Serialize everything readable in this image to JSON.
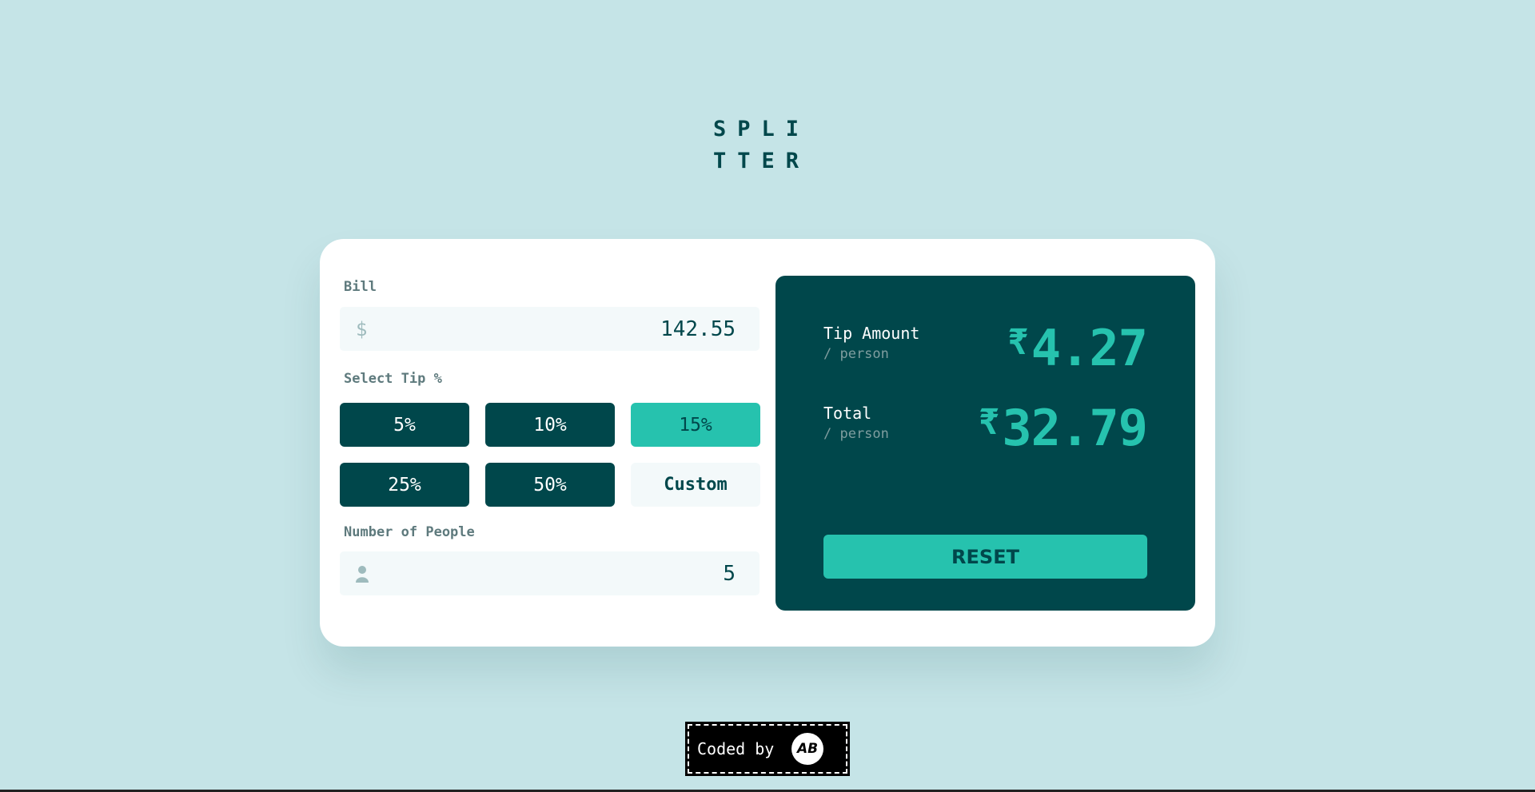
{
  "logo": {
    "line1": "SPLI",
    "line2": "TTER"
  },
  "bill": {
    "label": "Bill",
    "currency_symbol": "$",
    "value": "142.55"
  },
  "tip": {
    "label": "Select Tip %",
    "options": [
      {
        "label": "5%",
        "selected": false
      },
      {
        "label": "10%",
        "selected": false
      },
      {
        "label": "15%",
        "selected": true
      },
      {
        "label": "25%",
        "selected": false
      },
      {
        "label": "50%",
        "selected": false
      }
    ],
    "custom_label": "Custom"
  },
  "people": {
    "label": "Number of People",
    "value": "5"
  },
  "results": {
    "tip_amount": {
      "label": "Tip Amount",
      "per_label": "/ person",
      "currency": "₹",
      "value": "4.27"
    },
    "total": {
      "label": "Total",
      "per_label": "/ person",
      "currency": "₹",
      "value": "32.79"
    },
    "reset_label": "RESET"
  },
  "footer": {
    "coded_by": "Coded by",
    "logo_text": "AB"
  },
  "colors": {
    "background": "#c5e4e7",
    "dark_cyan": "#00474b",
    "accent": "#26c2ae",
    "input_bg": "#f3f9fa"
  }
}
